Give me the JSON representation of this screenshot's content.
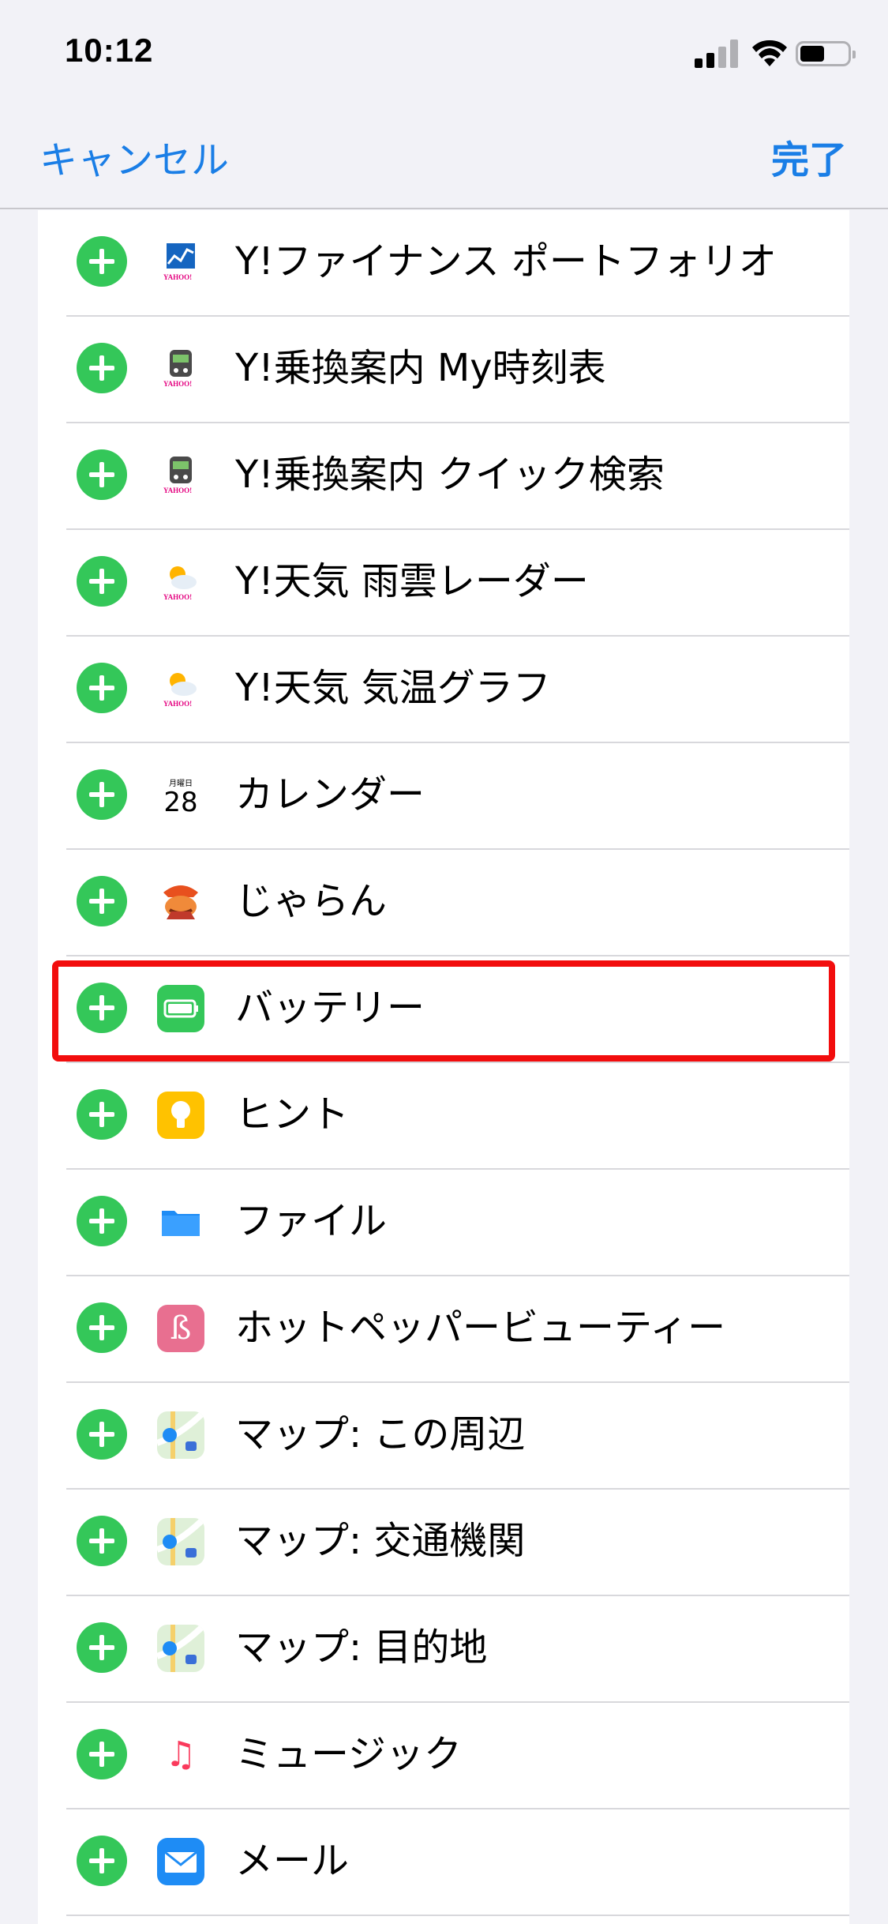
{
  "status": {
    "time": "10:12"
  },
  "nav": {
    "cancel": "キャンセル",
    "done": "完了"
  },
  "items": [
    {
      "label": "Y!ファイナンス ポートフォリオ",
      "icon": "yahoo-finance-icon",
      "brand": "YAHOO!"
    },
    {
      "label": "Y!乗換案内 My時刻表",
      "icon": "yahoo-transit-icon",
      "brand": "YAHOO!"
    },
    {
      "label": "Y!乗換案内 クイック検索",
      "icon": "yahoo-transit-icon",
      "brand": "YAHOO!"
    },
    {
      "label": "Y!天気 雨雲レーダー",
      "icon": "yahoo-weather-icon",
      "brand": "YAHOO!"
    },
    {
      "label": "Y!天気 気温グラフ",
      "icon": "yahoo-weather-icon",
      "brand": "YAHOO!"
    },
    {
      "label": "カレンダー",
      "icon": "calendar-icon",
      "cal_day": "月曜日",
      "cal_date": "28"
    },
    {
      "label": "じゃらん",
      "icon": "jalan-icon"
    },
    {
      "label": "バッテリー",
      "icon": "battery-icon",
      "highlighted": true
    },
    {
      "label": "ヒント",
      "icon": "tips-icon"
    },
    {
      "label": "ファイル",
      "icon": "files-icon"
    },
    {
      "label": "ホットペッパービューティー",
      "icon": "hotpepper-beauty-icon",
      "glyph": "ß"
    },
    {
      "label": "マップ: この周辺",
      "icon": "maps-icon"
    },
    {
      "label": "マップ: 交通機関",
      "icon": "maps-icon"
    },
    {
      "label": "マップ: 目的地",
      "icon": "maps-icon"
    },
    {
      "label": "ミュージック",
      "icon": "music-icon",
      "glyph": "♫"
    },
    {
      "label": "メール",
      "icon": "mail-icon"
    }
  ],
  "colors": {
    "accent": "#1a7ee6",
    "add": "#34c759",
    "highlight": "#f20d0d"
  }
}
